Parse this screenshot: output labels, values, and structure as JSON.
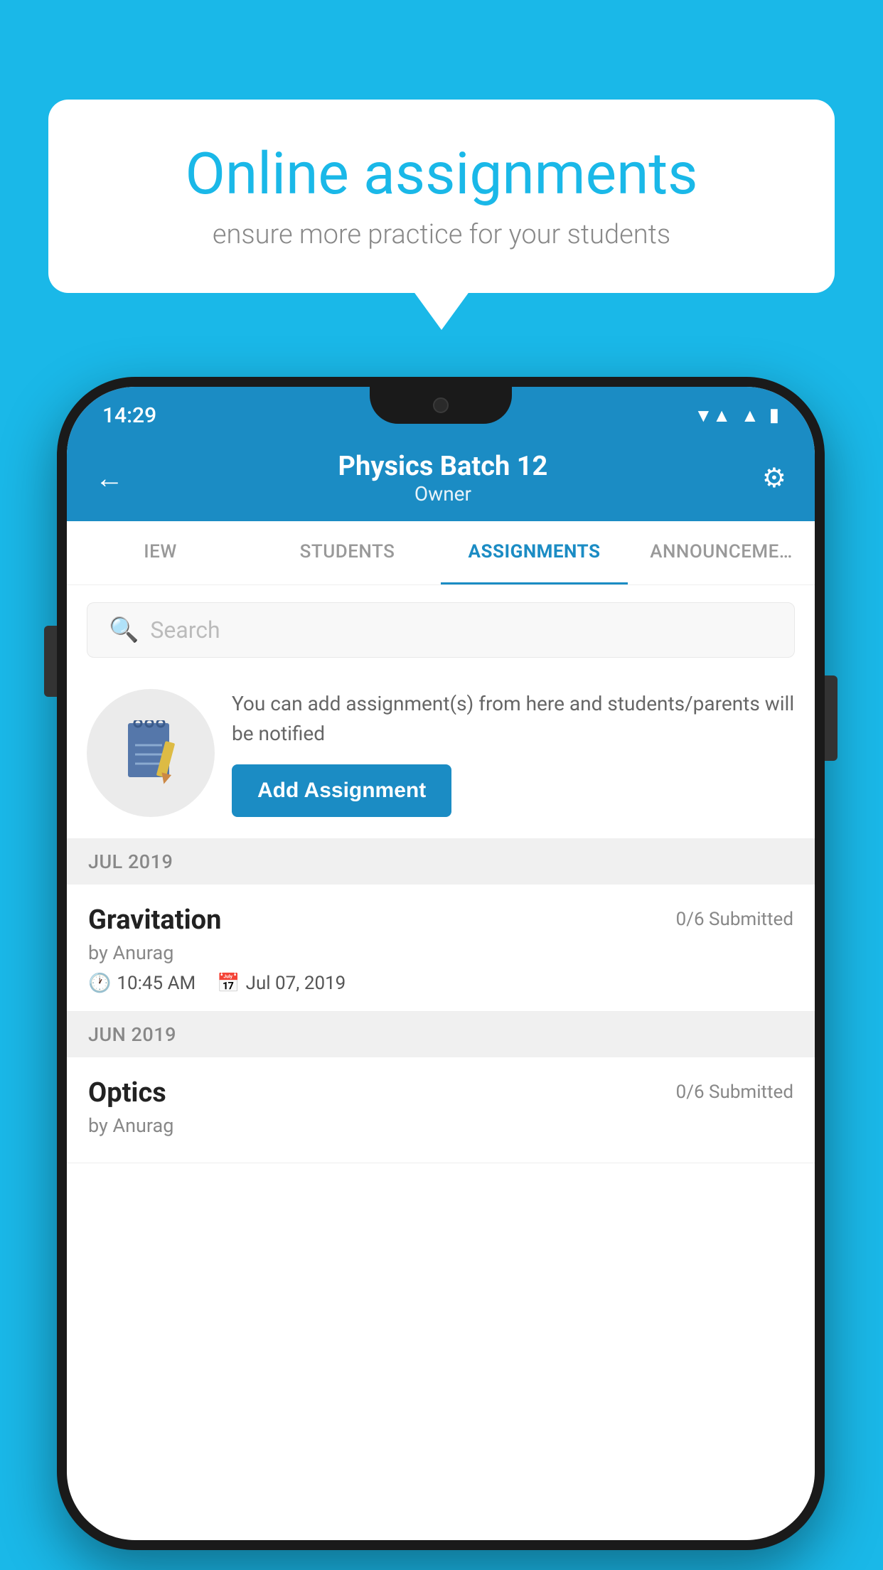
{
  "background_color": "#1ab8e8",
  "speech_bubble": {
    "title": "Online assignments",
    "subtitle": "ensure more practice for your students"
  },
  "status_bar": {
    "time": "14:29",
    "icons": [
      "wifi",
      "signal",
      "battery"
    ]
  },
  "header": {
    "title": "Physics Batch 12",
    "subtitle": "Owner",
    "back_label": "←",
    "settings_label": "⚙"
  },
  "tabs": [
    {
      "label": "IEW",
      "active": false
    },
    {
      "label": "STUDENTS",
      "active": false
    },
    {
      "label": "ASSIGNMENTS",
      "active": true
    },
    {
      "label": "ANNOUNCE…",
      "active": false
    }
  ],
  "search": {
    "placeholder": "Search"
  },
  "promo": {
    "description": "You can add assignment(s) from here and students/parents will be notified",
    "button_label": "Add Assignment"
  },
  "sections": [
    {
      "month": "JUL 2019",
      "assignments": [
        {
          "name": "Gravitation",
          "submitted": "0/6 Submitted",
          "by": "by Anurag",
          "time": "10:45 AM",
          "date": "Jul 07, 2019"
        }
      ]
    },
    {
      "month": "JUN 2019",
      "assignments": [
        {
          "name": "Optics",
          "submitted": "0/6 Submitted",
          "by": "by Anurag",
          "time": "",
          "date": ""
        }
      ]
    }
  ]
}
